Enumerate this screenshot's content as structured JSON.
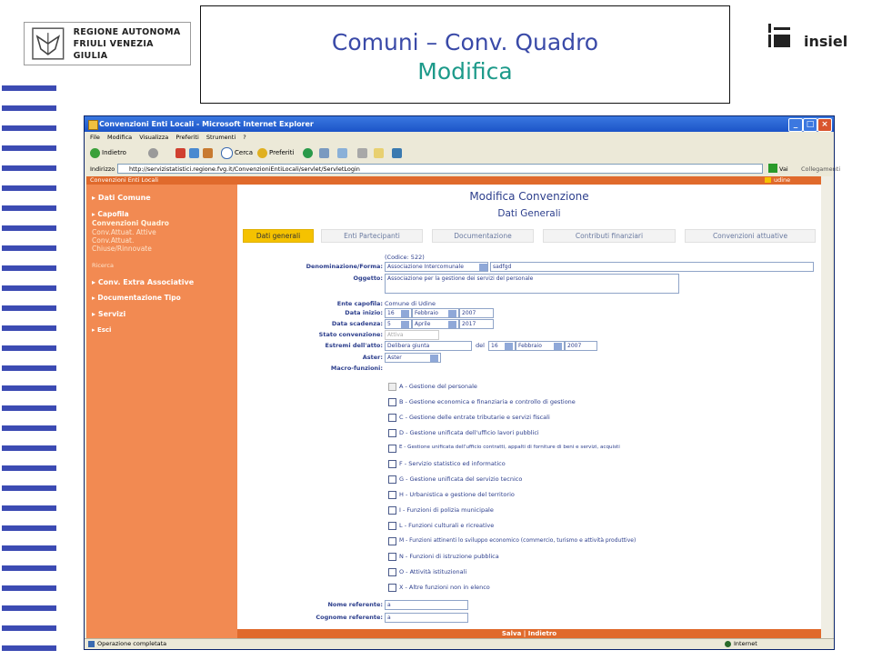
{
  "slide": {
    "logo_text_line1": "REGIONE AUTONOMA",
    "logo_text_line2": "FRIULI VENEZIA GIULIA",
    "title_line1": "Comuni – Conv. Quadro",
    "title_line2": "Modifica",
    "brand_label": "insiel"
  },
  "browser": {
    "title": "Convenzioni Enti Locali - Microsoft Internet Explorer",
    "menu": [
      "File",
      "Modifica",
      "Visualizza",
      "Preferiti",
      "Strumenti",
      "?"
    ],
    "toolbar": {
      "back": "Indietro",
      "search": "Cerca",
      "favorites": "Preferiti"
    },
    "address_label": "Indirizzo",
    "address": "http://servizistatistici.regione.fvg.it/ConvenzioniEntiLocali/servlet/ServletLogin",
    "go_label": "Vai",
    "links_label": "Collegamenti",
    "status": "Operazione completata",
    "zone": "Internet"
  },
  "app": {
    "header_left": "Convenzioni Enti Locali",
    "header_user": "udine"
  },
  "sidebar": {
    "items": [
      {
        "label": "Dati Comune"
      },
      {
        "label": "Capofila"
      },
      {
        "label": "Conv. Extra Associative"
      },
      {
        "label": "Documentazione Tipo"
      },
      {
        "label": "Servizi"
      },
      {
        "label": "Esci"
      }
    ],
    "subitems": [
      "Convenzioni Quadro",
      "Conv.Attuat. Attive",
      "Conv.Attuat.",
      "Chiuse/Rinnovate",
      "Ricerca"
    ]
  },
  "main": {
    "title": "Modifica Convenzione",
    "subtitle": "Dati Generali",
    "tabs": [
      "Dati generali",
      "Enti Partecipanti",
      "Documentazione",
      "Contributi finanziari",
      "Convenzioni attuative"
    ],
    "code": "(Codice: 522)",
    "labels": {
      "denominazione": "Denominazione/Forma:",
      "oggetto": "Oggetto:",
      "ente": "Ente capofila:",
      "data_inizio": "Data inizio:",
      "data_scadenza": "Data scadenza:",
      "stato": "Stato convenzione:",
      "estremi": "Estremi dell'atto:",
      "aster": "Aster:",
      "macro": "Macro-funzioni:",
      "nome": "Nome referente:",
      "cognome": "Cognome referente:"
    },
    "values": {
      "forma": "Associazione Intercomunale",
      "denominazione": "sadfgd",
      "oggetto": "Associazione per la gestione dei servizi del personale",
      "ente": "Comune di Udine",
      "inizio_g": "16",
      "inizio_m": "Febbraio",
      "inizio_a": "2007",
      "scad_g": "5",
      "scad_m": "Aprile",
      "scad_a": "2017",
      "stato": "Attiva",
      "estremi_tipo": "Delibera giunta",
      "del": "del",
      "estremi_g": "16",
      "estremi_m": "Febbraio",
      "estremi_a": "2007",
      "aster": "Aster",
      "nome": "a",
      "cognome": "a"
    },
    "macro_funzioni": [
      "A - Gestione del personale",
      "B - Gestione economica e finanziaria e controllo di gestione",
      "C - Gestione delle entrate tributarie e servizi fiscali",
      "D - Gestione unificata dell'ufficio lavori pubblici",
      "E - Gestione unificata dell'ufficio contratti, appalti di forniture di beni e servizi, acquisti",
      "F - Servizio statistico ed informatico",
      "G - Gestione unificata del servizio tecnico",
      "H - Urbanistica e gestione del territorio",
      "I - Funzioni di polizia municipale",
      "L - Funzioni culturali e ricreative",
      "M - Funzioni attinenti lo sviluppo economico (commercio, turismo e attività produttive)",
      "N - Funzioni di istruzione pubblica",
      "O - Attività istituzionali",
      "X - Altre funzioni non in elenco"
    ],
    "footer": "Salva | Indietro"
  }
}
